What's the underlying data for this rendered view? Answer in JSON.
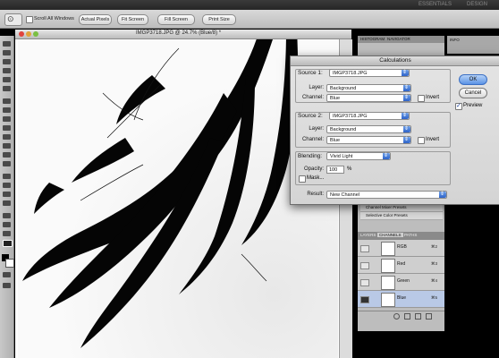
{
  "appbar": {
    "essentials": "ESSENTIALS",
    "design": "DESIGN"
  },
  "options_bar": {
    "scroll_all_windows": "Scroll All Windows",
    "actual_pixels": "Actual Pixels",
    "fit_screen": "Fit Screen",
    "fill_screen": "Fill Screen",
    "print_size": "Print Size"
  },
  "document": {
    "title": "IMGP3718.JPG @ 24.7% (Blue/8) *"
  },
  "panels": {
    "tab_histogram": "HISTOGRAM",
    "tab_navigator": "NAVIGATOR",
    "tab_info": "INFO",
    "presets": [
      "Channel Mixer Presets",
      "Selective Color Presets"
    ]
  },
  "channels_panel": {
    "tabs": [
      "LAYERS",
      "CHANNELS",
      "PATHS"
    ],
    "rows": [
      {
        "name": "RGB",
        "key": "⌘2"
      },
      {
        "name": "Red",
        "key": "⌘3"
      },
      {
        "name": "Green",
        "key": "⌘4"
      },
      {
        "name": "Blue",
        "key": "⌘5"
      }
    ]
  },
  "dialog": {
    "title": "Calculations",
    "source1": {
      "legend": "Source 1:",
      "file": "IMGP3718.JPG",
      "layer_label": "Layer:",
      "layer": "Background",
      "channel_label": "Channel:",
      "channel": "Blue",
      "invert": "Invert"
    },
    "source2": {
      "legend": "Source 2:",
      "file": "IMGP3718.JPG",
      "layer_label": "Layer:",
      "layer": "Background",
      "channel_label": "Channel:",
      "channel": "Blue",
      "invert": "Invert"
    },
    "blending": {
      "label": "Blending:",
      "mode": "Vivid Light",
      "opacity_label": "Opacity:",
      "opacity": "100",
      "percent": "%",
      "mask": "Mask..."
    },
    "result": {
      "label": "Result:",
      "value": "New Channel"
    },
    "ok": "OK",
    "cancel": "Cancel",
    "preview": "Preview"
  }
}
